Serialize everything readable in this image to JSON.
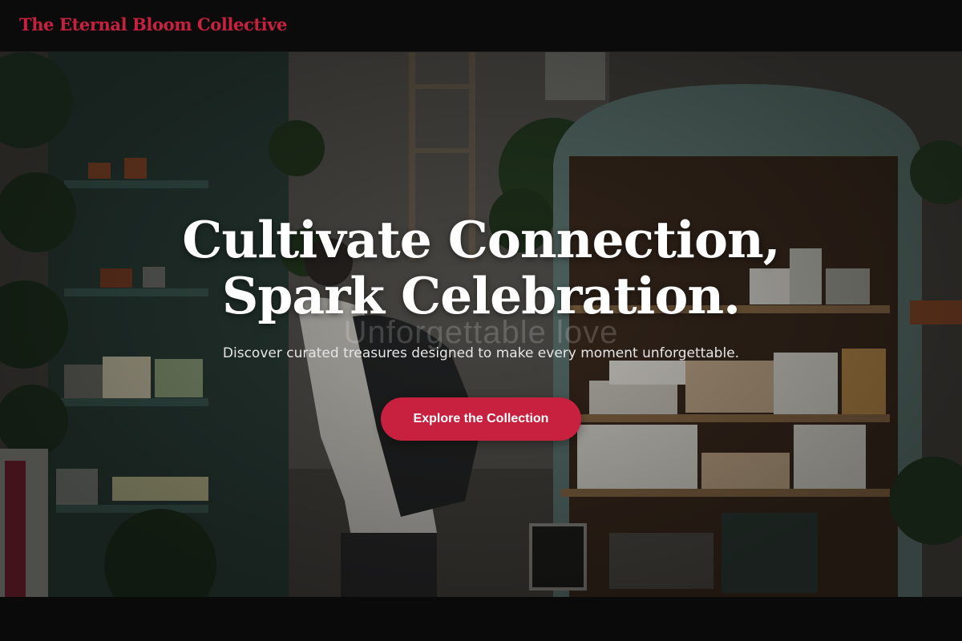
{
  "header": {
    "brand": "The Eternal Bloom Collective"
  },
  "hero": {
    "title_line1": "Cultivate Connection,",
    "title_line2": "Spark Celebration.",
    "watermark": "Unforgettable love",
    "subtitle": "Discover curated treasures designed to make every moment unforgettable.",
    "cta_label": "Explore the Collection"
  },
  "colors": {
    "accent": "#c8213f",
    "background": "#0a0a0a",
    "cabinet_green": "#3d5a52"
  }
}
